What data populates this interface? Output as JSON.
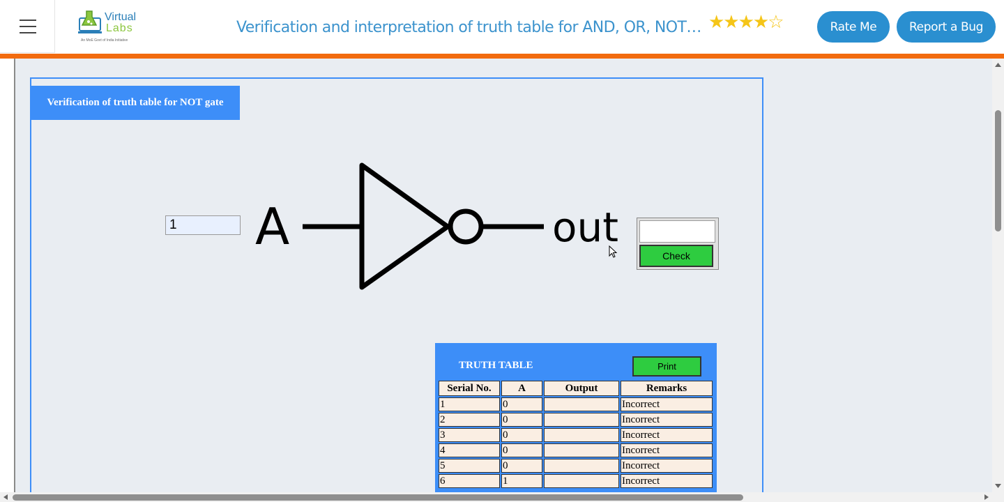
{
  "header": {
    "title": "Verification and interpretation of truth table for AND, OR, NOT, NAND, NOR, Ex-OR, Ex-NOR Gates",
    "rating_stars": "★★★★☆",
    "rate_label": "Rate Me",
    "bug_label": "Report a Bug",
    "logo_line1": "Virtual",
    "logo_line2": "Labs",
    "logo_tagline": "An MoE Govt of India Initiative"
  },
  "panel": {
    "title": "Verification of truth table for NOT gate"
  },
  "gate": {
    "input_value": "1",
    "input_label": "A",
    "output_label": "out",
    "output_value": "",
    "check_label": "Check"
  },
  "truth_table": {
    "title": "TRUTH TABLE",
    "print_label": "Print",
    "columns": [
      "Serial No.",
      "A",
      "Output",
      "Remarks"
    ],
    "rows": [
      {
        "serial": "1",
        "a": "0",
        "output": "",
        "remarks": "Incorrect"
      },
      {
        "serial": "2",
        "a": "0",
        "output": "",
        "remarks": "Incorrect"
      },
      {
        "serial": "3",
        "a": "0",
        "output": "",
        "remarks": "Incorrect"
      },
      {
        "serial": "4",
        "a": "0",
        "output": "",
        "remarks": "Incorrect"
      },
      {
        "serial": "5",
        "a": "0",
        "output": "",
        "remarks": "Incorrect"
      },
      {
        "serial": "6",
        "a": "1",
        "output": "",
        "remarks": "Incorrect"
      }
    ]
  },
  "colors": {
    "accent_blue": "#3d8ef8",
    "header_button_blue": "#2a8fd0",
    "orange_bar": "#f26b0f",
    "check_green": "#2ecc40",
    "star_gold": "#f5c518"
  }
}
